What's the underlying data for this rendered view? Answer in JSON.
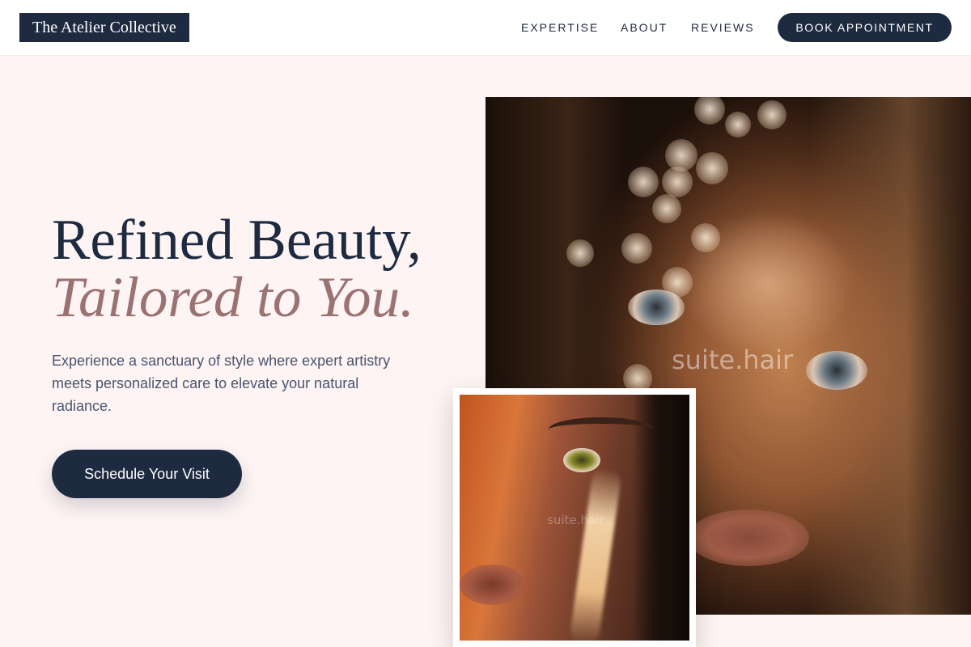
{
  "header": {
    "logo": "The Atelier Collective",
    "nav": [
      {
        "id": "expertise",
        "label": "EXPERTISE"
      },
      {
        "id": "about",
        "label": "ABOUT"
      },
      {
        "id": "reviews",
        "label": "REVIEWS"
      }
    ],
    "cta": "BOOK APPOINTMENT"
  },
  "hero": {
    "title_line1": "Refined Beauty,",
    "title_line2": "Tailored to You.",
    "subtitle": "Experience a sanctuary of style where expert artistry meets personalized care to elevate your natural radiance.",
    "cta": "Schedule Your Visit"
  },
  "images": {
    "main_watermark": "suite.hair",
    "small_watermark": "suite.hair"
  },
  "colors": {
    "navy": "#1e2a40",
    "mauve": "#9b7272",
    "background": "#fdf4f3"
  }
}
